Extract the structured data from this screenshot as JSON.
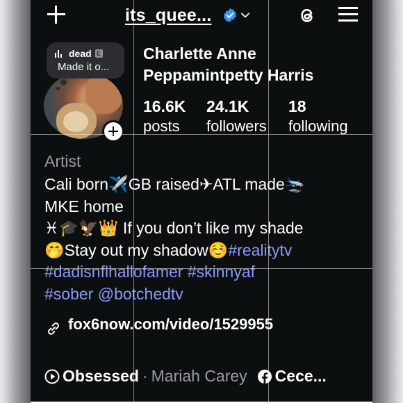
{
  "top_bar": {
    "username": "its_quee..."
  },
  "note": {
    "track": "dead",
    "explicit": "E",
    "text": "Made it o..."
  },
  "profile": {
    "display_name_line1": "Charlette Anne",
    "display_name_line2": "Peppamintpetty Harris",
    "stats": [
      {
        "value": "16.6K",
        "label": "posts"
      },
      {
        "value": "24.1K",
        "label": "followers"
      },
      {
        "value": "18",
        "label": "following"
      }
    ]
  },
  "bio": {
    "category": "Artist",
    "line1_a": "Cali born",
    "line1_b": "GB raised",
    "line1_c": "ATL made",
    "line2": "MKE home",
    "line3_emoji": "♓🎓🦅👑",
    "line3_text": " If you don’t like my shade",
    "line4_emoji": "🤭",
    "line4_text": "Stay out my shadow",
    "line4_emoji2": "☺️",
    "hashtag_realitytv": "#realitytv",
    "line5": "#dadisnflhallofamer #skinnyaf",
    "line6": "#sober @botchedtv"
  },
  "link": {
    "url": "fox6now.com/video/1529955"
  },
  "music": {
    "song": "Obsessed",
    "separator": "·",
    "artist": "Mariah Carey",
    "facebook_name": "Cece..."
  },
  "colors": {
    "background": "#0c0f10",
    "hashtag": "#8c98f5",
    "verified": "#3897f0",
    "secondary_text": "#9a9ca0"
  }
}
